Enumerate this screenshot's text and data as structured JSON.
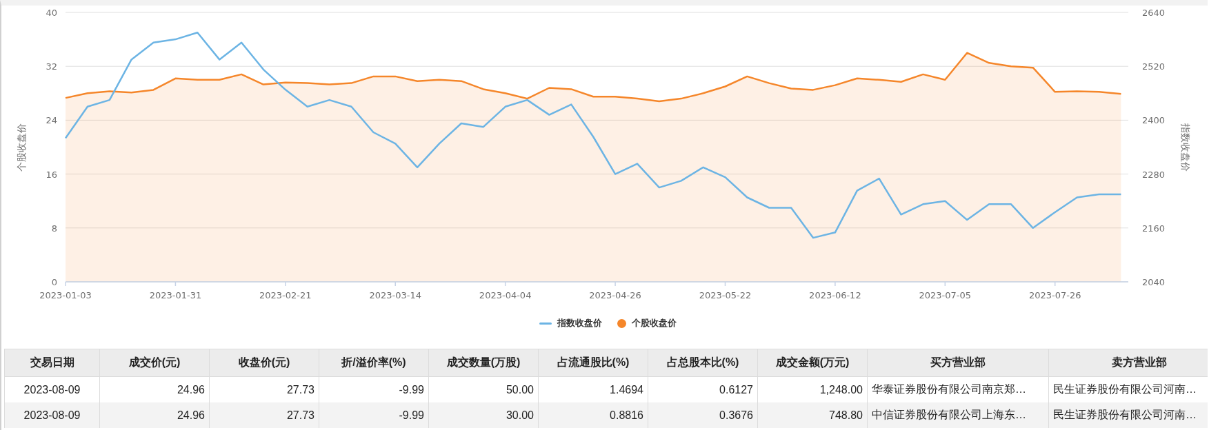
{
  "chart": {
    "chart_data": {
      "type": "line",
      "grid": true,
      "legend": "bottom",
      "ylabel": "个股收盘价",
      "y2label": "指数收盘价",
      "categories": [
        "2023-01-03",
        null,
        null,
        null,
        null,
        "2023-01-31",
        null,
        null,
        null,
        null,
        "2023-02-21",
        null,
        null,
        null,
        null,
        "2023-03-14",
        null,
        null,
        null,
        null,
        "2023-04-04",
        null,
        null,
        null,
        null,
        "2023-04-26",
        null,
        null,
        null,
        null,
        "2023-05-22",
        null,
        null,
        null,
        null,
        "2023-06-12",
        null,
        null,
        null,
        null,
        "2023-07-05",
        null,
        null,
        null,
        null,
        "2023-07-26",
        null,
        null,
        null
      ],
      "ylim": [
        0,
        40
      ],
      "yticks": [
        0,
        8,
        16,
        24,
        32,
        40
      ],
      "y2lim": [
        2040,
        2640
      ],
      "y2ticks": [
        2040,
        2160,
        2280,
        2400,
        2520,
        2640
      ],
      "series": [
        {
          "name": "指数收盘价",
          "color": "#6cb4e4",
          "axis": "y2",
          "values": [
            2360,
            2430,
            2445,
            2535,
            2573,
            2580,
            2595,
            2535,
            2573,
            2513,
            2468,
            2430,
            2445,
            2430,
            2373,
            2348,
            2295,
            2348,
            2393,
            2385,
            2430,
            2445,
            2412,
            2435,
            2363,
            2280,
            2303,
            2250,
            2265,
            2295,
            2273,
            2228,
            2205,
            2205,
            2138,
            2150,
            2243,
            2270,
            2190,
            2213,
            2220,
            2178,
            2213,
            2213,
            2160,
            2195,
            2228,
            2235,
            2235
          ]
        },
        {
          "name": "个股收盘价",
          "color": "#f5862a",
          "type": "area",
          "values": [
            27.3,
            28.0,
            28.3,
            28.1,
            28.5,
            30.2,
            30.0,
            30.0,
            30.8,
            29.3,
            29.6,
            29.5,
            29.3,
            29.5,
            30.5,
            30.5,
            29.8,
            30.0,
            29.8,
            28.6,
            28.0,
            27.2,
            28.8,
            28.6,
            27.5,
            27.5,
            27.2,
            26.8,
            27.2,
            28.0,
            29.0,
            30.5,
            29.5,
            28.7,
            28.5,
            29.2,
            30.2,
            30.0,
            29.7,
            30.8,
            30.0,
            34.0,
            32.5,
            32.0,
            31.8,
            28.2,
            28.3,
            28.2,
            27.9
          ]
        }
      ]
    }
  },
  "table": {
    "columns": [
      "交易日期",
      "成交价(元)",
      "收盘价(元)",
      "折/溢价率(%)",
      "成交数量(万股)",
      "占流通股比(%)",
      "占总股本比(%)",
      "成交金额(万元)",
      "买方营业部",
      "卖方营业部"
    ],
    "rows": [
      {
        "cells": [
          "2023-08-09",
          "24.96",
          "27.73",
          "-9.99",
          "50.00",
          "1.4694",
          "0.6127",
          "1,248.00",
          "华泰证券股份有限公司南京郑…",
          "民生证券股份有限公司河南…"
        ]
      },
      {
        "cells": [
          "2023-08-09",
          "24.96",
          "27.73",
          "-9.99",
          "30.00",
          "0.8816",
          "0.3676",
          "748.80",
          "中信证券股份有限公司上海东…",
          "民生证券股份有限公司河南…"
        ]
      }
    ]
  }
}
